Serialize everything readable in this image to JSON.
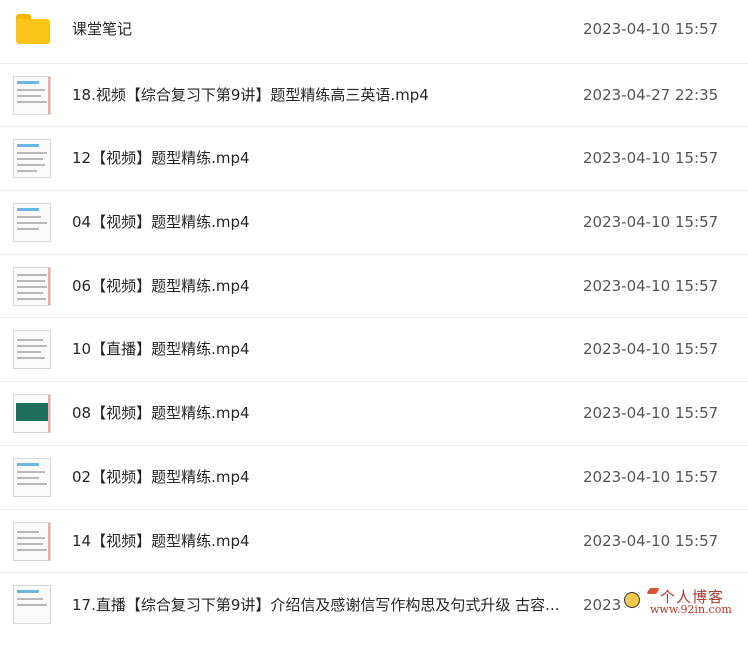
{
  "files": [
    {
      "type": "folder",
      "name": "课堂笔记",
      "date": "2023-04-10 15:57"
    },
    {
      "type": "video",
      "name": "18.视频【综合复习下第9讲】题型精练高三英语.mp4",
      "date": "2023-04-27 22:35"
    },
    {
      "type": "video",
      "name": "12【视频】题型精练.mp4",
      "date": "2023-04-10 15:57"
    },
    {
      "type": "video",
      "name": "04【视频】题型精练.mp4",
      "date": "2023-04-10 15:57"
    },
    {
      "type": "video",
      "name": "06【视频】题型精练.mp4",
      "date": "2023-04-10 15:57"
    },
    {
      "type": "video",
      "name": "10【直播】题型精练.mp4",
      "date": "2023-04-10 15:57"
    },
    {
      "type": "video",
      "name": "08【视频】题型精练.mp4",
      "date": "2023-04-10 15:57"
    },
    {
      "type": "video",
      "name": "02【视频】题型精练.mp4",
      "date": "2023-04-10 15:57"
    },
    {
      "type": "video",
      "name": "14【视频】题型精练.mp4",
      "date": "2023-04-10 15:57"
    },
    {
      "type": "video",
      "name": "17.直播【综合复习下第9讲】介绍信及感谢信写作构思及句式升级 古容...",
      "date": "2023"
    }
  ],
  "watermark": {
    "title": "个人博客",
    "url": "www.92in.com"
  },
  "colors": {
    "folder": "#fcc419",
    "divider": "#ececec",
    "date_text": "#555555"
  }
}
